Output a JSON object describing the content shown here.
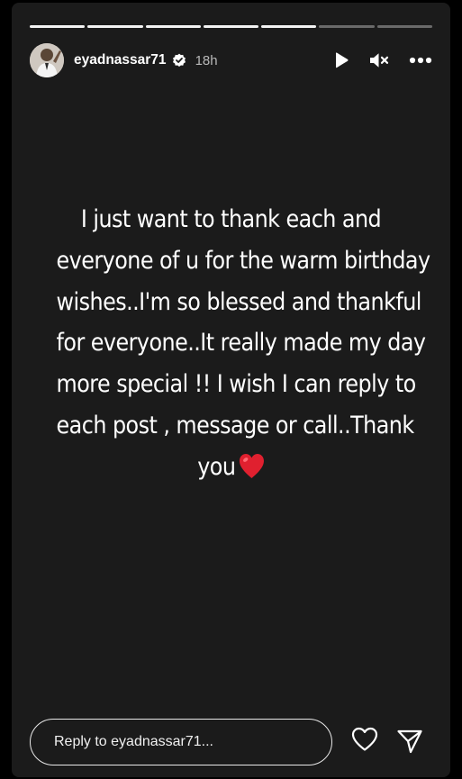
{
  "story": {
    "progress": {
      "segments_total": 7,
      "segments_viewed": 5
    },
    "author": {
      "username": "eyadnassar71",
      "verified": true,
      "time": "18h"
    },
    "controls": {
      "play_icon": "play-icon",
      "mute_icon": "muted-speaker-icon",
      "more_icon": "more-options-icon"
    },
    "text_lines": [
      "I just want to thank each and",
      "everyone of u for the warm birthday",
      "wishes..I'm so blessed and thankful",
      "for everyone..It really made my day",
      "more special !!  I wish I can reply to",
      "each post , message or call..Thank",
      "you"
    ],
    "emoji": "heart-emoji"
  },
  "reply": {
    "placeholder": "Reply to eyadnassar71..."
  },
  "actions": {
    "like_icon": "heart-icon",
    "share_icon": "send-icon"
  },
  "colors": {
    "background": "#1b1b1b",
    "text": "#ffffff",
    "heart": "#e0202f"
  }
}
